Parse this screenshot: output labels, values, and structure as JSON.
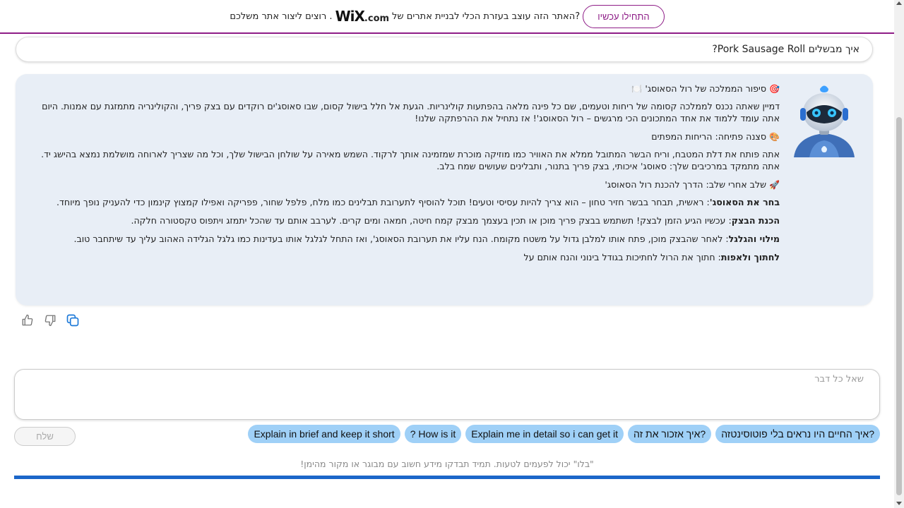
{
  "banner": {
    "cta_label": "התחילו עכשיו",
    "text_before": "?האתר הזה עוצב בעזרת הכלי לבניית אתרים של",
    "logo": "WiX",
    "dotcom": ".com",
    "text_after": ". רוצים ליצור אתר משלכם",
    "accent": "#8e1d87"
  },
  "question": {
    "text": "איך מבשלים Pork Sausage Roll?"
  },
  "answer": {
    "title_emoji": "🎯",
    "title": "סיפור הממלכה של רול הסאוסג'",
    "title_emoji_end": "🍽️",
    "intro": "דמיין שאתה נכנס לממלכה קסומה של ריחות וטעמים, שם כל פינה מלאה בהפתעות קולינריות. הגעת אל חלל בישול קסום, שבו סאוסג'ים רוקדים עם בצק פריך, והקולינריה מתמזגת עם אמנות. היום אתה עומד ללמוד את אחד המתכונים הכי מרגשים – רול הסאוסג'! אז נתחיל את ההרפתקה שלנו!",
    "scene_emoji": "🎨",
    "scene_title": "סצנה פתיחה: הריחות המפתים",
    "scene_text": "אתה פותח את דלת המטבח, וריח הבשר המתובל ממלא את האוויר כמו מוזיקה מוכרת שמזמינה אותך לרקוד. השמש מאירה על שולחן הבישול שלך, וכל מה שצריך לארוחה מושלמת נמצא בהישג יד. אתה מתמקד במרכיבים שלך: סאוסג' איכותי, בצק פריך בתנור, ותבלינים שעושים שמח בלב.",
    "steps_emoji": "🚀",
    "steps_title": "שלב אחרי שלב: הדרך להכנת רול הסאוסג'",
    "steps": [
      {
        "label": "בחר את הסאוסג'",
        "text": ": ראשית, תבחר בבשר חזיר טחון – הוא צריך להיות עסיסי וטעים! תוכל להוסיף לתערובת תבלינים כמו מלח, פלפל שחור, פפריקה ואפילו קמצוץ קינמון כדי להעניק נופך מיוחד."
      },
      {
        "label": "הכנת הבצק",
        "text": ": עכשיו הגיע הזמן לבצק! תשתמש בבצק פריך מוכן או תכין בעצמך מבצק קמח חיטה, חמאה ומים קרים. לערבב אותם עד שהכל יתמזג ויתפוס טקסטורה חלקה."
      },
      {
        "label": "מילוי והגלגל",
        "text": ": לאחר שהבצק מוכן, פתח אותו למלבן גדול על משטח מקומח. הנח עליו את תערובת הסאוסג', ואז התחל לגלגל אותו בעדינות כמו גלגל הגלידה האהוב עליך עד שיתחבר טוב."
      },
      {
        "label": "לחתוך ולאפות",
        "text": ": חתוך את הרול לחתיכות בגודל בינוני והנח אותם על"
      }
    ]
  },
  "feedback": {
    "like_icon": "thumbs-up-icon",
    "dislike_icon": "thumbs-down-icon",
    "copy_icon": "copy-icon"
  },
  "input": {
    "placeholder": "שאל כל דבר",
    "value": ""
  },
  "chips": [
    "?איך החיים היו נראים בלי פוטוסינטזה",
    "?איך אזכור את זה",
    "Explain me in detail so i can get it",
    "? How is it",
    "Explain in brief and keep it short"
  ],
  "send_label": "שלח",
  "disclaimer": "\"בלו\" יכול לפעמים לטעות. תמיד תבדקו מידע חשוב עם מבוגר או מקור מהימן!",
  "colors": {
    "chip_bg": "#9fd0f7",
    "answer_bg": "#e8eef6",
    "bottom_bar": "#1b66c9"
  }
}
